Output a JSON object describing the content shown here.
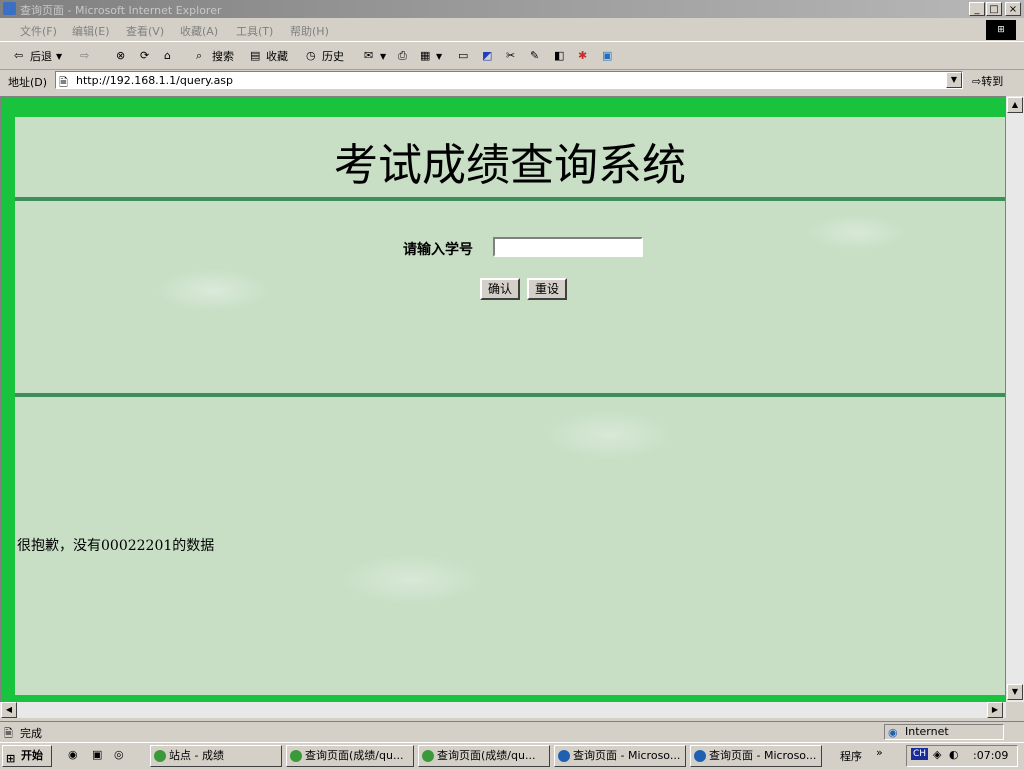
{
  "window": {
    "title": "查询页面 - Microsoft Internet Explorer",
    "min": "_",
    "max": "□",
    "close": "×"
  },
  "menu": [
    "文件(F)",
    "编辑(E)",
    "查看(V)",
    "收藏(A)",
    "工具(T)",
    "帮助(H)"
  ],
  "toolbar": {
    "back": "后退",
    "search": "搜索",
    "favorites": "收藏",
    "history": "历史"
  },
  "address": {
    "label": "地址(D)",
    "url": "http://192.168.1.1/query.asp",
    "go": "转到"
  },
  "page": {
    "title": "考试成绩查询系统",
    "student_id_label": "请输入学号",
    "student_id_value": "",
    "confirm_button": "确认",
    "reset_button": "重设",
    "message": "很抱歉，没有00022201的数据"
  },
  "status": {
    "text": "完成",
    "zone": "Internet"
  },
  "taskbar": {
    "start": "开始",
    "tasks": [
      "站点 - 成绩",
      "查询页面(成绩/qu...",
      "查询页面(成绩/qu...",
      "查询页面 - Microso...",
      "查询页面 - Microso..."
    ],
    "programs": "程序",
    "ime": "CH",
    "clock": ":07:09"
  },
  "colors": {
    "frame_green": "#19c33e",
    "page_bg": "#c8dfc6",
    "rule": "#3e8e5a"
  }
}
